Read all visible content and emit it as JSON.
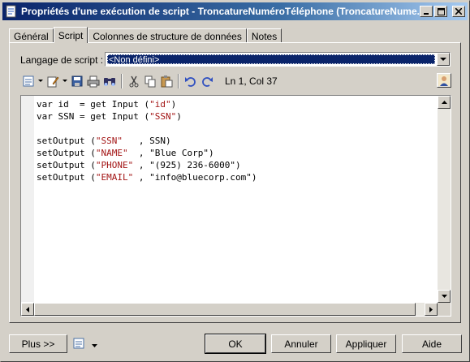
{
  "window": {
    "title": "Propriétés d'une exécution de script - TroncatureNuméroTéléphone (TroncatureNume...",
    "controls": [
      "minimize-icon",
      "maximize-icon",
      "close-icon"
    ]
  },
  "tabs": [
    {
      "label": "Général",
      "active": false
    },
    {
      "label": "Script",
      "active": true
    },
    {
      "label": "Colonnes de structure de données",
      "active": false
    },
    {
      "label": "Notes",
      "active": false
    }
  ],
  "language": {
    "label": "Langage de script :",
    "selected": "<Non défini>"
  },
  "toolbar": {
    "icons": [
      "properties-icon",
      "edit-icon",
      "save-icon",
      "print-icon",
      "find-icon",
      "cut-icon",
      "copy-icon",
      "paste-icon",
      "undo-icon",
      "redo-icon"
    ],
    "position": "Ln 1, Col 37",
    "user_icon": "user-icon"
  },
  "code": {
    "lines": [
      [
        "var id  = get Input (",
        "\"id\"",
        ")"
      ],
      [
        "var SSN = get Input (",
        "\"SSN\"",
        ")"
      ],
      [
        "",
        "",
        ""
      ],
      [
        "setOutput (",
        "\"SSN\"",
        "   , SSN)"
      ],
      [
        "setOutput (",
        "\"NAME\"",
        "  , \"Blue Corp\")"
      ],
      [
        "setOutput (",
        "\"PHONE\"",
        " , \"(925) 236-6000\")"
      ],
      [
        "setOutput (",
        "\"EMAIL\"",
        " , \"info@bluecorp.com\")"
      ]
    ]
  },
  "buttons": {
    "more": "Plus >>",
    "ok": "OK",
    "cancel": "Annuler",
    "apply": "Appliquer",
    "help": "Aide"
  },
  "colors": {
    "title_start": "#0a246a",
    "title_end": "#a6caf0",
    "string": "#a31515"
  }
}
